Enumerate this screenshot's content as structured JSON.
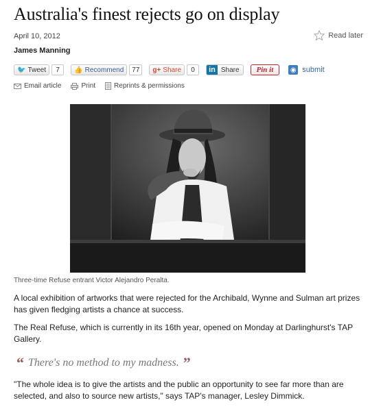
{
  "article": {
    "headline": "Australia's finest rejects go on display",
    "date": "April 10, 2012",
    "author": "James Manning",
    "read_later": "Read later"
  },
  "share": {
    "tweet_label": "Tweet",
    "tweet_count": "7",
    "recommend_label": "Recommend",
    "recommend_count": "77",
    "gplus_label": "Share",
    "gplus_count": "0",
    "linkedin_label": "Share",
    "pinit_label": "Pin it",
    "submit_label": "submit"
  },
  "utilities": {
    "email": "Email article",
    "print": "Print",
    "reprints": "Reprints & permissions"
  },
  "photo": {
    "caption": "Three-time Refuse entrant Victor Alejandro Peralta."
  },
  "body": {
    "p1": "A local exhibition of artworks that were rejected for the Archibald, Wynne and Sulman art prizes has given fledging artists a chance at success.",
    "p2": "The Real Refuse, which is currently in its 16th year, opened on Monday at Darlinghurst's TAP Gallery.",
    "pullquote": "There's no method to my madness.",
    "p3": "\"The whole idea is to give the artists and the public an opportunity to see far more than are selected, and also to source new artists,\" says TAP's manager, Lesley Dimmick."
  }
}
